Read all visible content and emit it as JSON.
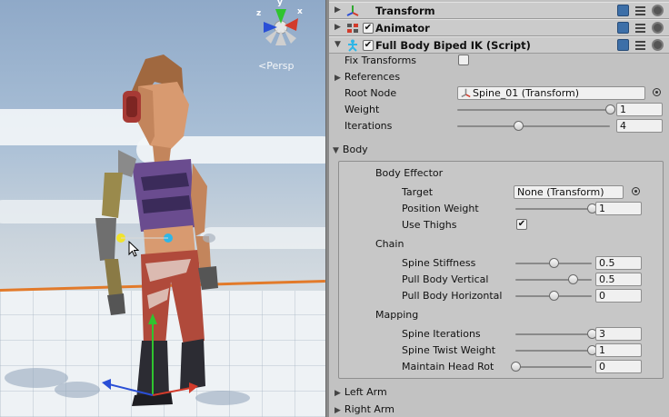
{
  "scene": {
    "persp_label": "Persp",
    "gizmo_axes": {
      "z": "z",
      "x": "x",
      "y": "y"
    }
  },
  "inspector": {
    "components": [
      {
        "title": "Transform",
        "has_checkbox": false
      },
      {
        "title": "Animator",
        "has_checkbox": true,
        "checked": true
      },
      {
        "title": "Full Body Biped IK (Script)",
        "has_checkbox": true,
        "checked": true
      }
    ],
    "fields": {
      "fix_transforms": {
        "label": "Fix Transforms",
        "checked": false
      },
      "references": {
        "label": "References"
      },
      "root_node": {
        "label": "Root Node",
        "value": "Spine_01 (Transform)"
      },
      "weight": {
        "label": "Weight",
        "value": "1",
        "fraction": 1
      },
      "iterations": {
        "label": "Iterations",
        "value": "4",
        "fraction": 0.4
      },
      "body": {
        "label": "Body"
      }
    },
    "body": {
      "effector_heading": "Body Effector",
      "target": {
        "label": "Target",
        "value": "None (Transform)"
      },
      "position_weight": {
        "label": "Position Weight",
        "value": "1",
        "fraction": 1
      },
      "use_thighs": {
        "label": "Use Thighs",
        "checked": true
      },
      "chain_heading": "Chain",
      "spine_stiffness": {
        "label": "Spine Stiffness",
        "value": "0.5",
        "fraction": 0.5
      },
      "pull_body_vertical": {
        "label": "Pull Body Vertical",
        "value": "0.5",
        "fraction": 0.75
      },
      "pull_body_horizontal": {
        "label": "Pull Body Horizontal",
        "value": "0",
        "fraction": 0.5
      },
      "mapping_heading": "Mapping",
      "spine_iterations": {
        "label": "Spine Iterations",
        "value": "3",
        "fraction": 1
      },
      "spine_twist_weight": {
        "label": "Spine Twist Weight",
        "value": "1",
        "fraction": 1
      },
      "maintain_head_rot": {
        "label": "Maintain Head Rot",
        "value": "0",
        "fraction": 0
      }
    },
    "left_arm": {
      "label": "Left Arm"
    },
    "right_arm": {
      "label": "Right Arm"
    }
  },
  "colors": {
    "horizon": "#e27a2a",
    "book_icon": "#3d6fa8"
  }
}
